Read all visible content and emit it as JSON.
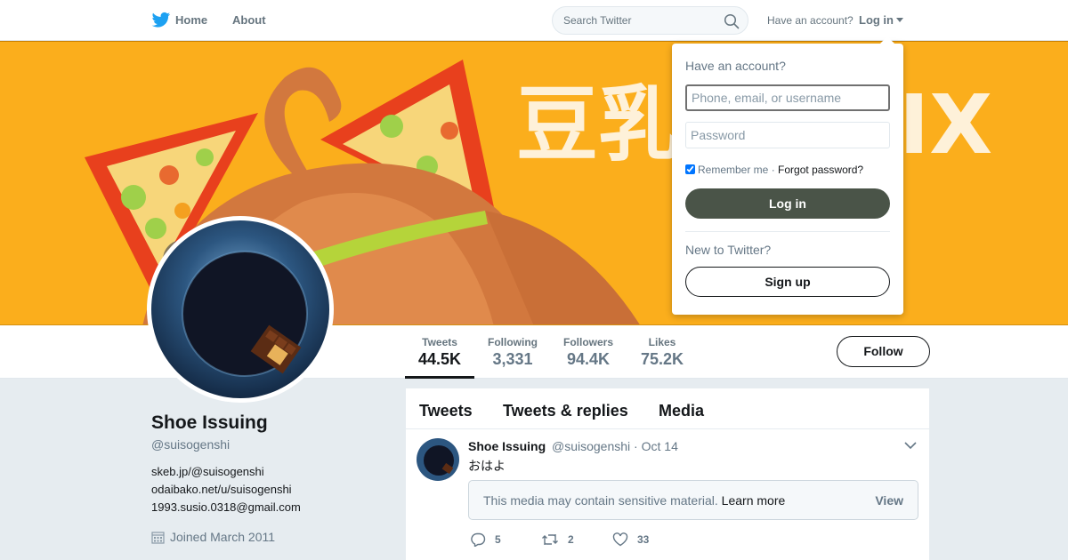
{
  "nav": {
    "home_label": "Home",
    "about_label": "About",
    "search_placeholder": "Search Twitter",
    "have_account": "Have an account?",
    "login_label": "Log in"
  },
  "banner": {
    "text_left": "豆乳",
    "text_right": "IX"
  },
  "profile": {
    "name": "Shoe Issuing",
    "handle": "@suisogenshi",
    "bio_lines": [
      "skeb.jp/@suisogenshi",
      "odaibako.net/u/suisogenshi",
      "1993.susio.0318@gmail.com"
    ],
    "joined": "Joined March 2011"
  },
  "stats": [
    {
      "label": "Tweets",
      "value": "44.5K"
    },
    {
      "label": "Following",
      "value": "3,331"
    },
    {
      "label": "Followers",
      "value": "94.4K"
    },
    {
      "label": "Likes",
      "value": "75.2K"
    }
  ],
  "follow_label": "Follow",
  "timeline": {
    "tabs": [
      "Tweets",
      "Tweets & replies",
      "Media"
    ],
    "tweet": {
      "name": "Shoe Issuing",
      "handle": "@suisogenshi",
      "date": "Oct 14",
      "text": "おはよ",
      "sensitive_text": "This media may contain sensitive material.",
      "learn_more": "Learn more",
      "view": "View",
      "replies": "5",
      "retweets": "2",
      "likes": "33"
    }
  },
  "login_dropdown": {
    "title": "Have an account?",
    "username_placeholder": "Phone, email, or username",
    "password_placeholder": "Password",
    "remember_me": "Remember me",
    "separator": "·",
    "forgot_password": "Forgot password?",
    "login_button": "Log in",
    "new_to_twitter": "New to Twitter?",
    "signup_button": "Sign up"
  },
  "colors": {
    "banner_bg": "#fbae1c",
    "accent_dark": "#4a5448",
    "twitter_blue": "#1da1f2"
  }
}
